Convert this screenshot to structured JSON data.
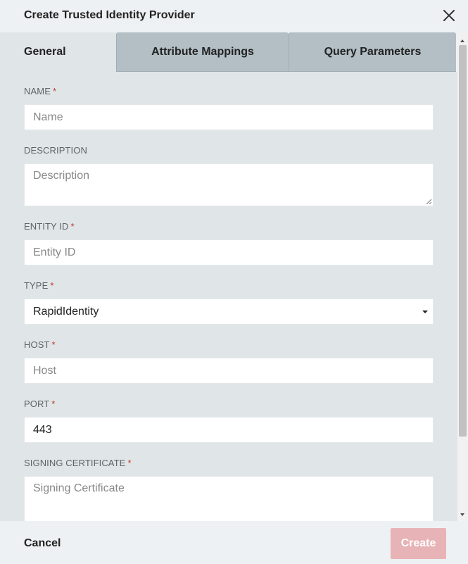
{
  "dialog": {
    "title": "Create Trusted Identity Provider",
    "close_icon": "close-icon"
  },
  "tabs": [
    {
      "label": "General",
      "active": true
    },
    {
      "label": "Attribute Mappings",
      "active": false
    },
    {
      "label": "Query Parameters",
      "active": false
    }
  ],
  "form": {
    "name": {
      "label": "NAME",
      "required": "*",
      "placeholder": "Name",
      "value": ""
    },
    "description": {
      "label": "DESCRIPTION",
      "placeholder": "Description",
      "value": ""
    },
    "entity_id": {
      "label": "ENTITY ID",
      "required": "*",
      "placeholder": "Entity ID",
      "value": ""
    },
    "type": {
      "label": "TYPE",
      "required": "*",
      "value": "RapidIdentity"
    },
    "host": {
      "label": "HOST",
      "required": "*",
      "placeholder": "Host",
      "value": ""
    },
    "port": {
      "label": "PORT",
      "required": "*",
      "value": "443"
    },
    "signing_certificate": {
      "label": "SIGNING CERTIFICATE",
      "required": "*",
      "placeholder": "Signing Certificate",
      "value": ""
    }
  },
  "footer": {
    "cancel_label": "Cancel",
    "create_label": "Create"
  },
  "colors": {
    "required": "#c0392b",
    "create_disabled": "#e8b3b6",
    "tab_inactive": "#b3bfc5",
    "body_bg": "#e0e5e8"
  }
}
